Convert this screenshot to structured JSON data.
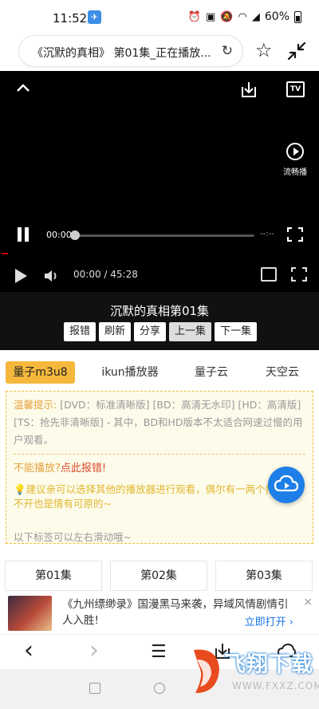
{
  "status_bar": {
    "time": "11:52",
    "battery": "60%",
    "network": "4G"
  },
  "url_bar": {
    "text": "《沉默的真相》 第01集_正在播放..."
  },
  "player": {
    "stream_label": "流畅播",
    "current_time": "00:00",
    "end_time": "--:--",
    "time_display": "00:00 / 45:28",
    "progress": 0
  },
  "episode_header": {
    "title": "沉默的真相第01集",
    "buttons": [
      "报错",
      "刷新",
      "分享",
      "上一集",
      "下一集"
    ]
  },
  "source_tabs": [
    "量子m3u8",
    "ikun播放器",
    "量子云",
    "天空云"
  ],
  "notice": {
    "label": "温馨提示:",
    "text": "[DVD：标准清晰版] [BD：高清无水印] [HD：高清版] [TS：抢先非清晰版] - 其中，BD和HD版本不太适合网速过慢的用户观看。",
    "error_prefix": "不能播放?",
    "error_link": "点此报错!",
    "tip": "建议亲可以选择其他的播放器进行观看，偶尔有一两个播放器打不开也是情有可原的~",
    "swipe_hint": "以下标签可以左右滑动哦~"
  },
  "episodes": [
    "第01集",
    "第02集",
    "第03集"
  ],
  "ad": {
    "text": "《九州缥缈录》国漫黑马来袭，异域风情剧情引人入胜!",
    "open_label": "立即打开 ›",
    "close": "×"
  },
  "browser_nav": {
    "back": "‹",
    "forward": "›",
    "menu": "☰"
  },
  "watermark": {
    "text": "飞翔下载",
    "url": "WWW.FXXZ.COM"
  },
  "colors": {
    "accent_tab": "#f5b83c",
    "notice_border": "#f0c040",
    "link_red": "#d84a2c",
    "fab_blue": "#1e7fe8"
  }
}
